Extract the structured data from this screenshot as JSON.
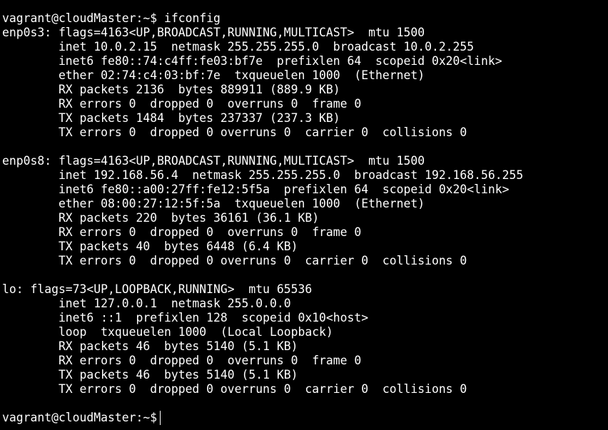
{
  "terminal": {
    "command_line": {
      "prompt": "vagrant@cloudMaster:~$",
      "command": "ifconfig"
    },
    "interfaces": [
      {
        "lines": [
          "enp0s3: flags=4163<UP,BROADCAST,RUNNING,MULTICAST>  mtu 1500",
          "        inet 10.0.2.15  netmask 255.255.255.0  broadcast 10.0.2.255",
          "        inet6 fe80::74:c4ff:fe03:bf7e  prefixlen 64  scopeid 0x20<link>",
          "        ether 02:74:c4:03:bf:7e  txqueuelen 1000  (Ethernet)",
          "        RX packets 2136  bytes 889911 (889.9 KB)",
          "        RX errors 0  dropped 0  overruns 0  frame 0",
          "        TX packets 1484  bytes 237337 (237.3 KB)",
          "        TX errors 0  dropped 0 overruns 0  carrier 0  collisions 0"
        ]
      },
      {
        "lines": [
          "enp0s8: flags=4163<UP,BROADCAST,RUNNING,MULTICAST>  mtu 1500",
          "        inet 192.168.56.4  netmask 255.255.255.0  broadcast 192.168.56.255",
          "        inet6 fe80::a00:27ff:fe12:5f5a  prefixlen 64  scopeid 0x20<link>",
          "        ether 08:00:27:12:5f:5a  txqueuelen 1000  (Ethernet)",
          "        RX packets 220  bytes 36161 (36.1 KB)",
          "        RX errors 0  dropped 0  overruns 0  frame 0",
          "        TX packets 40  bytes 6448 (6.4 KB)",
          "        TX errors 0  dropped 0 overruns 0  carrier 0  collisions 0"
        ]
      },
      {
        "lines": [
          "lo: flags=73<UP,LOOPBACK,RUNNING>  mtu 65536",
          "        inet 127.0.0.1  netmask 255.0.0.0",
          "        inet6 ::1  prefixlen 128  scopeid 0x10<host>",
          "        loop  txqueuelen 1000  (Local Loopback)",
          "        RX packets 46  bytes 5140 (5.1 KB)",
          "        RX errors 0  dropped 0  overruns 0  frame 0",
          "        TX packets 46  bytes 5140 (5.1 KB)",
          "        TX errors 0  dropped 0 overruns 0  carrier 0  collisions 0"
        ]
      }
    ],
    "final_prompt": "vagrant@cloudMaster:~$",
    "colors": {
      "background": "#000000",
      "foreground": "#ffffff"
    }
  }
}
